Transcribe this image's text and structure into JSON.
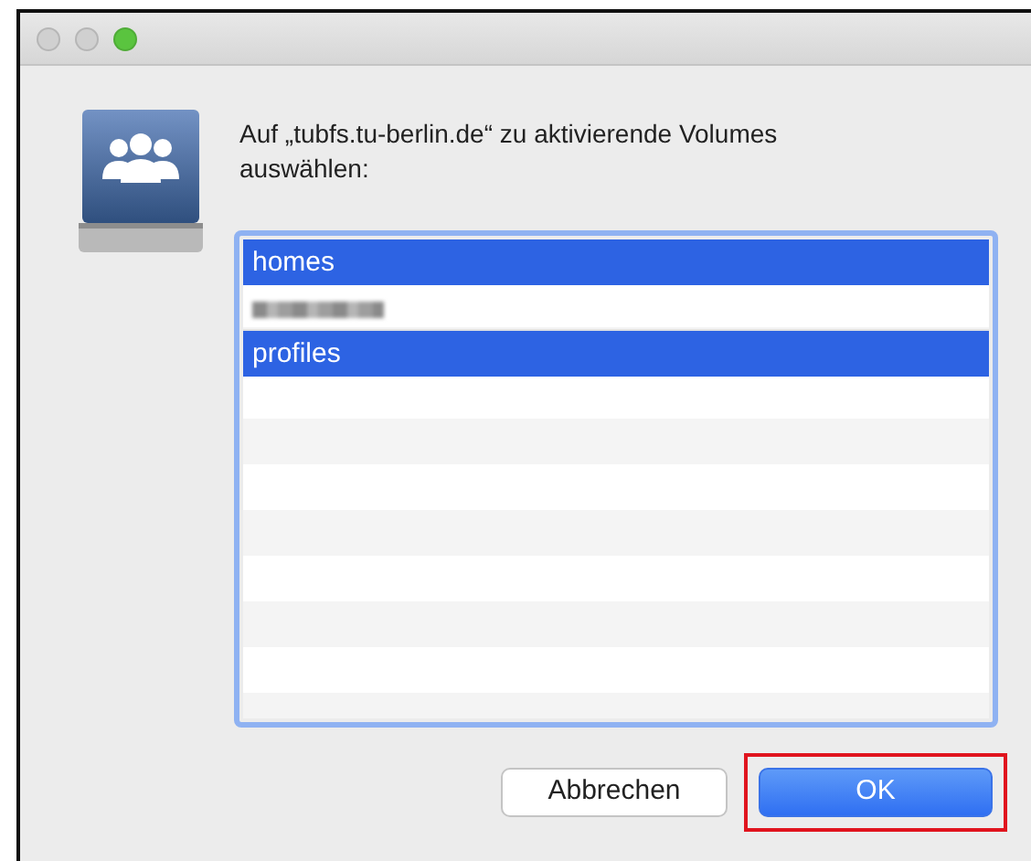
{
  "window": {
    "controls": [
      {
        "color": "#d0d0d0"
      },
      {
        "color": "#d0d0d0"
      },
      {
        "color": "#5ac43f"
      }
    ]
  },
  "message": "Auf „tubfs.tu-berlin.de“ zu aktivierende Volumes auswählen:",
  "volumes": [
    {
      "kind": "text",
      "label": "homes",
      "selected": true
    },
    {
      "kind": "blurred",
      "selected": false
    },
    {
      "kind": "text",
      "label": "profiles",
      "selected": true
    }
  ],
  "buttons": [
    {
      "label": "Abbrechen",
      "default": false,
      "highlighted": false
    },
    {
      "label": "OK",
      "default": true,
      "highlighted": true
    }
  ]
}
